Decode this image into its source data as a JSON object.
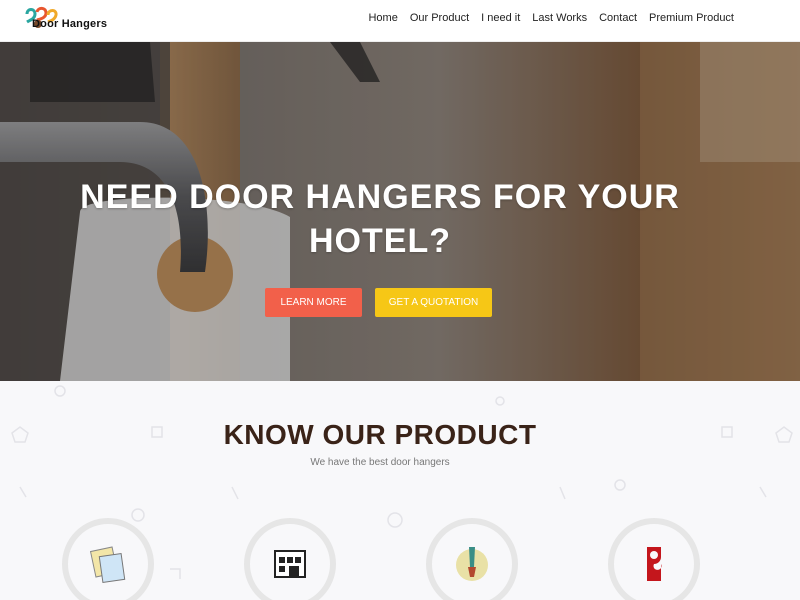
{
  "header": {
    "logo_text": "Door Hangers",
    "nav": [
      "Home",
      "Our Product",
      "I need it",
      "Last Works",
      "Contact",
      "Premium Product"
    ]
  },
  "hero": {
    "title_line1": "NEED DOOR HANGERS FOR YOUR",
    "title_line2": "HOTEL?",
    "learn_more": "LEARN MORE",
    "quote": "GET A QUOTATION"
  },
  "product_section": {
    "title": "KNOW OUR PRODUCT",
    "subtitle": "We have the best door hangers",
    "icons": [
      "documents-icon",
      "blueprint-icon",
      "paintbrush-icon",
      "door-hanger-icon"
    ]
  },
  "colors": {
    "accent_red": "#f2604a",
    "accent_yellow": "#f6c716",
    "title_brown": "#3a2318"
  }
}
